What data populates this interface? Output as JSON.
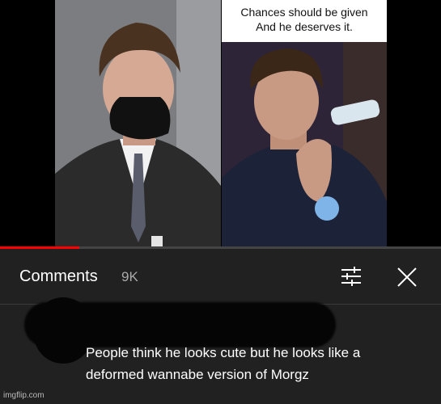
{
  "video": {
    "caption_line1": "Chances should be given",
    "caption_line2": "And he deserves it.",
    "progress_fraction": 0.18
  },
  "comments_panel": {
    "title": "Comments",
    "count": "9K",
    "sort_icon": "sort-icon",
    "close_icon": "close-icon"
  },
  "comment": {
    "text_line1": "People think he looks cute but he looks like a",
    "text_line2": "deformed wannabe version of Morgz"
  },
  "watermark": "imgflip.com",
  "colors": {
    "progress": "#ff0000",
    "panel_bg": "#212121"
  }
}
